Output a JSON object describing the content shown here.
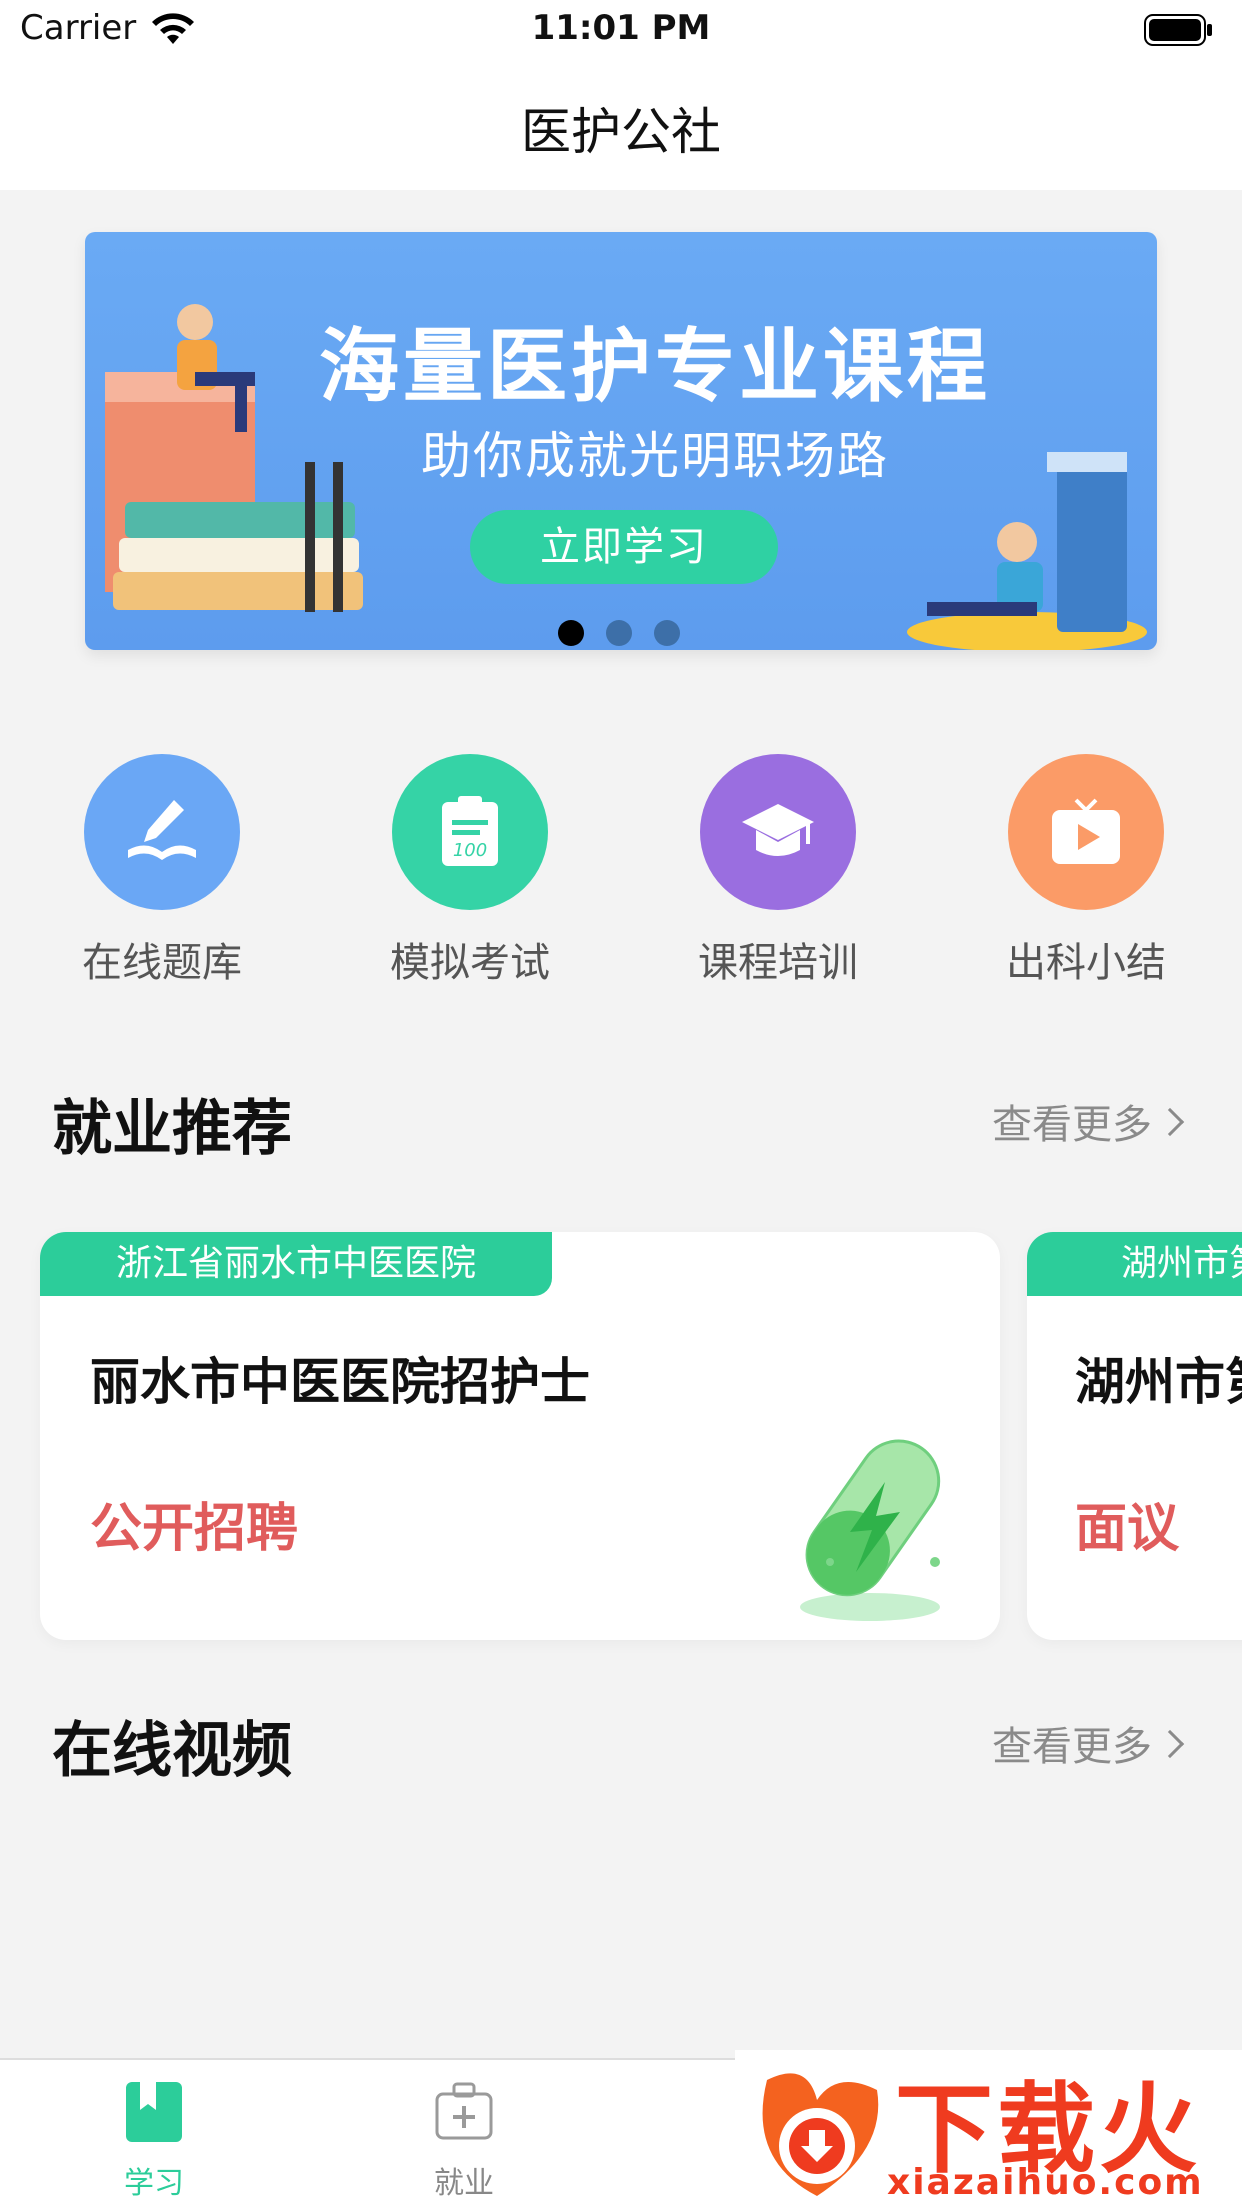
{
  "status_bar": {
    "carrier": "Carrier",
    "time": "11:01 PM",
    "icons": [
      "wifi-icon",
      "battery-icon"
    ]
  },
  "nav": {
    "title": "医护公社"
  },
  "banner": {
    "headline": "海量医护专业课程",
    "subheadline": "助你成就光明职场路",
    "cta": "立即学习",
    "page_count": 3,
    "active_page": 1
  },
  "quick_entries": [
    {
      "label": "在线题库",
      "icon": "book-pen-icon",
      "color": "#6aa7f5"
    },
    {
      "label": "模拟考试",
      "icon": "exam-100-icon",
      "color": "#35d3a6"
    },
    {
      "label": "课程培训",
      "icon": "graduation-cap-icon",
      "color": "#9a6ee0"
    },
    {
      "label": "出科小结",
      "icon": "video-play-icon",
      "color": "#fb9b67"
    }
  ],
  "jobs_section": {
    "title": "就业推荐",
    "more": "查看更多"
  },
  "jobs": [
    {
      "hospital": "浙江省丽水市中医医院",
      "title": "丽水市中医医院招护士",
      "salary": "公开招聘"
    },
    {
      "hospital": "湖州市第",
      "title": "湖州市第",
      "salary": "面议"
    }
  ],
  "video_section": {
    "title": "在线视频",
    "more": "查看更多"
  },
  "tab_bar": {
    "tabs": [
      {
        "label": "学习",
        "icon": "bookmark-icon",
        "active": true
      },
      {
        "label": "就业",
        "icon": "medical-kit-icon",
        "active": false
      }
    ],
    "active_color": "#2ccd9a"
  },
  "watermark": {
    "title": "下载火",
    "url": "xiazaihuo.com"
  }
}
